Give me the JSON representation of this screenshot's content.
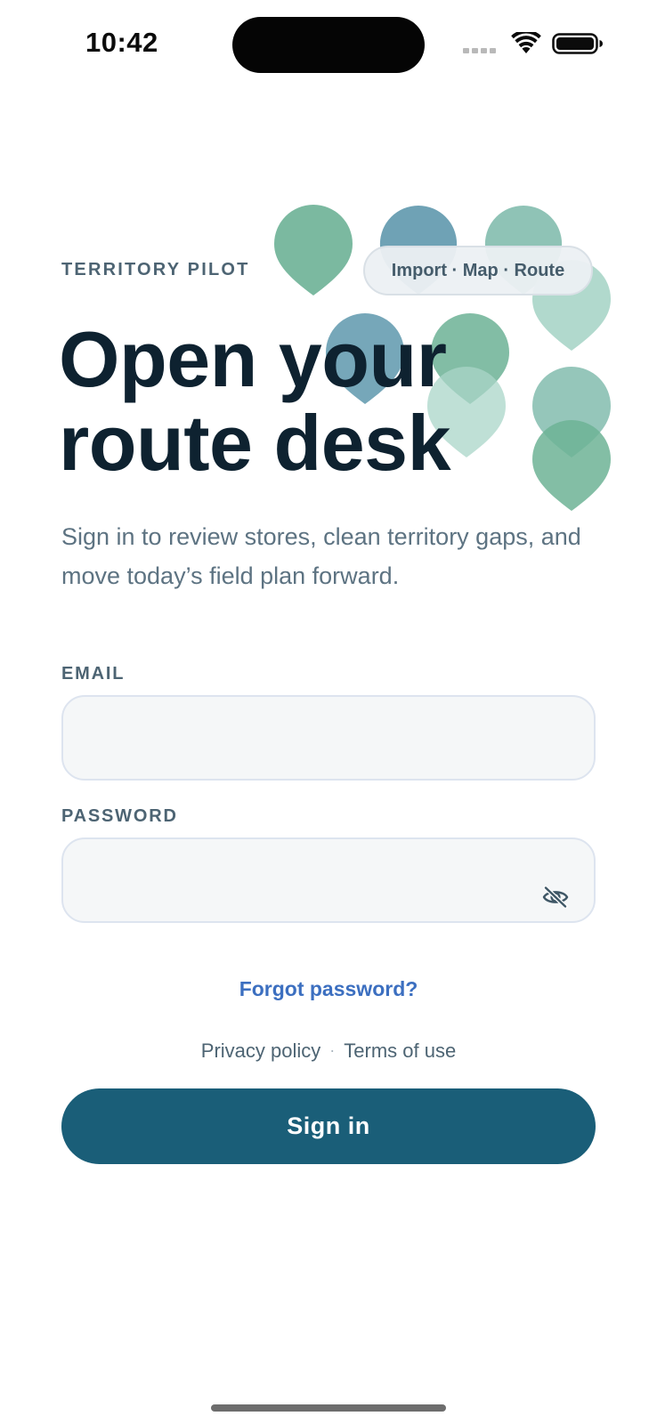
{
  "status_bar": {
    "time": "10:42"
  },
  "header": {
    "brand": "TERRITORY PILOT",
    "flow_chip": "Import · Map · Route",
    "title_line1": "Open your",
    "title_line2": "route desk",
    "subtitle": "Sign in to review stores, clean territory gaps, and move today’s field plan forward."
  },
  "form": {
    "email_label": "EMAIL",
    "email_value": "",
    "password_label": "PASSWORD",
    "password_value": "",
    "password_toggle_icon": "eye-slash-icon",
    "forgot_password": "Forgot password?",
    "privacy_policy": "Privacy policy",
    "legal_separator": "·",
    "terms_of_use": "Terms of use",
    "sign_in": "Sign in"
  },
  "colors": {
    "primary_button": "#1a5e78",
    "link": "#3c6fc0",
    "heading": "#0e2230",
    "muted_text": "#5d7382",
    "pin_green": "#7bb9a0",
    "pin_blue": "#6fa2b5",
    "pin_mint": "#a9d5c8"
  }
}
